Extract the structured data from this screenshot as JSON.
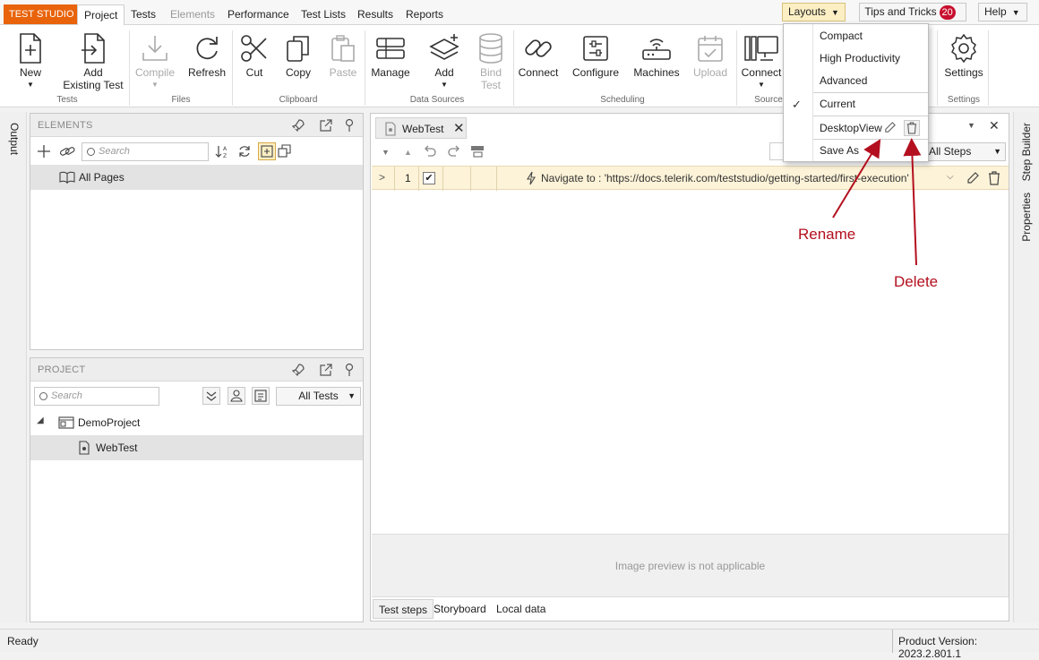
{
  "brand": "TEST STUDIO",
  "menu_tabs": [
    {
      "label": "Project",
      "state": "active"
    },
    {
      "label": "Tests",
      "state": "normal"
    },
    {
      "label": "Elements",
      "state": "disabled"
    },
    {
      "label": "Performance",
      "state": "normal"
    },
    {
      "label": "Test Lists",
      "state": "normal"
    },
    {
      "label": "Results",
      "state": "normal"
    },
    {
      "label": "Reports",
      "state": "normal"
    }
  ],
  "top_right": {
    "layouts_label": "Layouts",
    "tips_label": "Tips and Tricks",
    "tips_badge": "20",
    "help_label": "Help"
  },
  "ribbon": {
    "buttons": {
      "new": "New",
      "add_existing_1": "Add",
      "add_existing_2": "Existing Test",
      "compile": "Compile",
      "refresh": "Refresh",
      "cut": "Cut",
      "copy": "Copy",
      "paste": "Paste",
      "manage": "Manage",
      "add": "Add",
      "bind_1": "Bind",
      "bind_2": "Test",
      "connect": "Connect",
      "configure": "Configure",
      "machines": "Machines",
      "upload": "Upload",
      "connect_source": "Connect",
      "settings": "Settings"
    },
    "groups": {
      "tests": "Tests",
      "files": "Files",
      "clipboard": "Clipboard",
      "data_sources": "Data Sources",
      "scheduling": "Scheduling",
      "source": "Source",
      "settings": "Settings"
    }
  },
  "left_strip": {
    "output": "Output"
  },
  "right_strip": {
    "step_builder": "Step Builder",
    "properties": "Properties"
  },
  "elements_panel": {
    "title": "ELEMENTS",
    "search_placeholder": "Search",
    "items": [
      "All Pages"
    ]
  },
  "project_panel": {
    "title": "PROJECT",
    "search_placeholder": "Search",
    "filter": "All Tests",
    "tree": [
      {
        "label": "DemoProject",
        "level": 0
      },
      {
        "label": "WebTest",
        "level": 1
      }
    ]
  },
  "test_area": {
    "tab_label": "WebTest",
    "filter": "All Steps",
    "steps": [
      {
        "number": "1",
        "checked": true,
        "text": "Navigate to : 'https://docs.telerik.com/teststudio/getting-started/first-execution'"
      }
    ],
    "preview_text": "Image preview is not applicable",
    "subtabs": [
      "Test steps",
      "Storyboard",
      "Local data"
    ]
  },
  "layout_menu": {
    "items": [
      "Compact",
      "High Productivity",
      "Advanced"
    ],
    "current": "Current",
    "custom": "DesktopView",
    "save_as": "Save As"
  },
  "annotations": {
    "rename": "Rename",
    "delete": "Delete"
  },
  "status": {
    "left": "Ready",
    "right": "Product Version: 2023.2.801.1"
  },
  "colors": {
    "brand": "#e8630a",
    "annotation": "#b30f1e",
    "step_highlight": "#fdf3d8"
  }
}
